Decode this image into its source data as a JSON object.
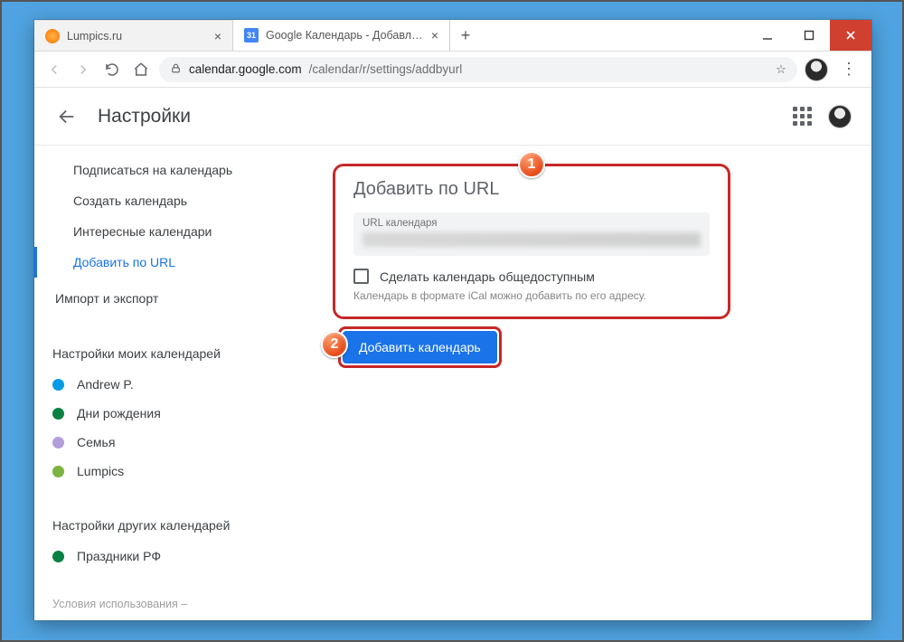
{
  "tabs": [
    {
      "title": "Lumpics.ru"
    },
    {
      "title": "Google Календарь - Добавлени",
      "favicon_text": "31"
    }
  ],
  "url": {
    "host": "calendar.google.com",
    "path": "/calendar/r/settings/addbyurl"
  },
  "header": {
    "title": "Настройки"
  },
  "sidebar": {
    "nav": {
      "subscribe": "Подписаться на календарь",
      "create": "Создать календарь",
      "interesting": "Интересные календари",
      "addbyurl": "Добавить по URL"
    },
    "import_export": "Импорт и экспорт",
    "group_my_title": "Настройки моих календарей",
    "my_calendars": [
      {
        "name": "Andrew P.",
        "color": "#039be5"
      },
      {
        "name": "Дни рождения",
        "color": "#0b8043"
      },
      {
        "name": "Семья",
        "color": "#b39ddb"
      },
      {
        "name": "Lumpics",
        "color": "#7cb342"
      }
    ],
    "group_other_title": "Настройки других календарей",
    "other_calendars": [
      {
        "name": "Праздники РФ",
        "color": "#0b8043"
      }
    ]
  },
  "main": {
    "heading": "Добавить по URL",
    "url_field_label": "URL календаря",
    "checkbox_label": "Сделать календарь общедоступным",
    "hint": "Календарь в формате iCal можно добавить по его адресу.",
    "button": "Добавить календарь",
    "badge1": "1",
    "badge2": "2"
  },
  "footer": {
    "terms": "Условия использования –"
  }
}
